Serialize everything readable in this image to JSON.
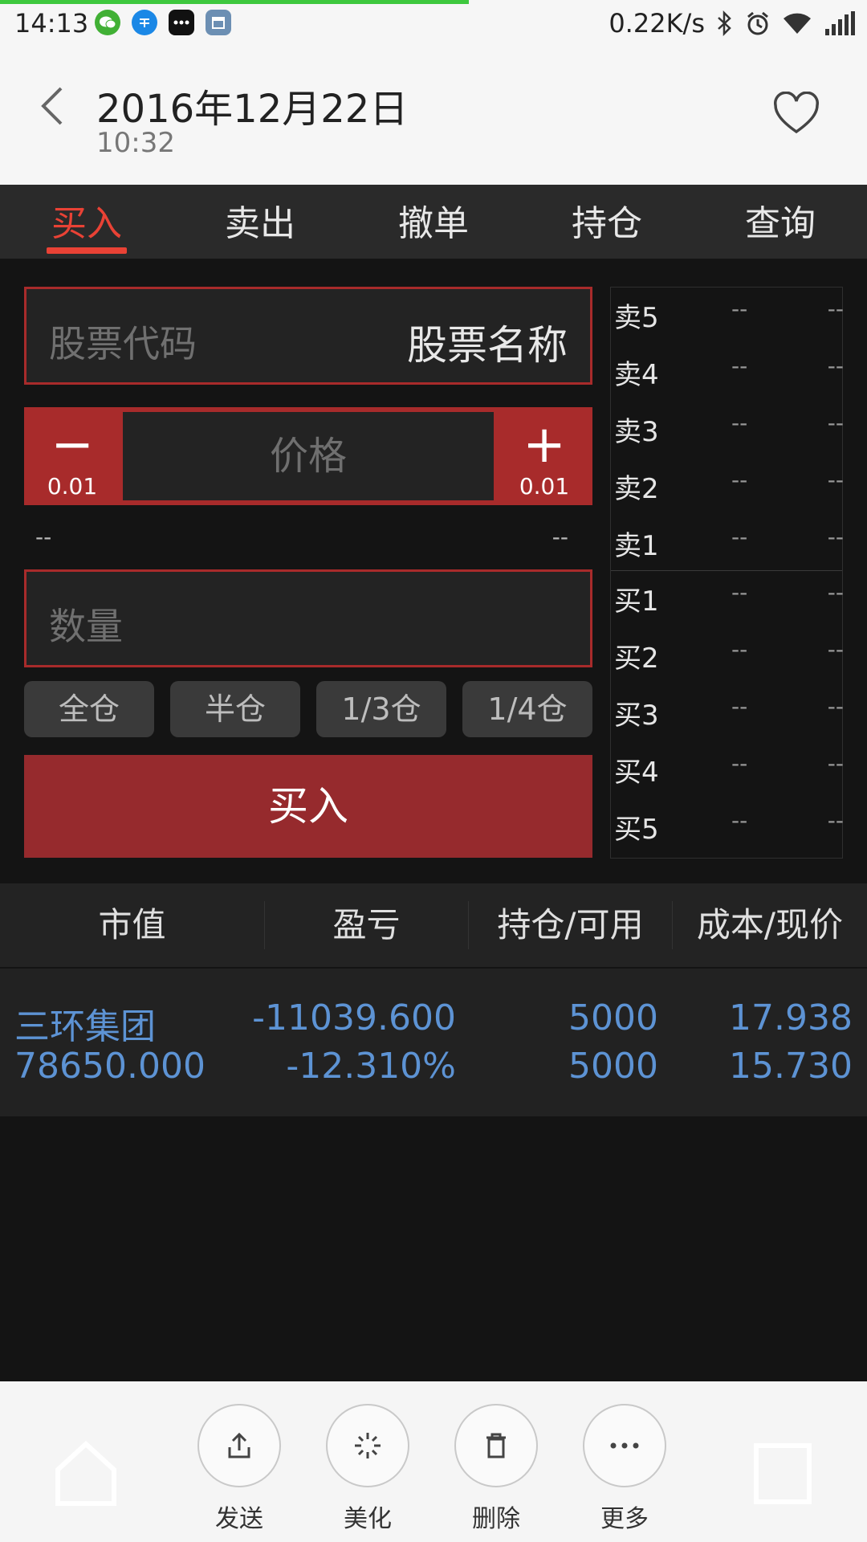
{
  "status_bar": {
    "time": "14:13",
    "speed": "0.22K/s",
    "icons": [
      "wechat-icon",
      "zhihu-icon",
      "tic-icon",
      "calendar-icon",
      "bluetooth-icon",
      "alarm-icon",
      "wifi-icon",
      "signal-icon"
    ]
  },
  "header": {
    "date": "2016年12月22日",
    "time": "10:32"
  },
  "tabs": [
    {
      "label": "买入",
      "active": true
    },
    {
      "label": "卖出",
      "active": false
    },
    {
      "label": "撤单",
      "active": false
    },
    {
      "label": "持仓",
      "active": false
    },
    {
      "label": "查询",
      "active": false
    }
  ],
  "trade": {
    "code_placeholder": "股票代码",
    "name_label": "股票名称",
    "price_placeholder": "价格",
    "minus_symbol": "−",
    "plus_symbol": "+",
    "step_value": "0.01",
    "limit_low": "--",
    "limit_high": "--",
    "qty_placeholder": "数量",
    "position_buttons": [
      "全仓",
      "半仓",
      "1/3仓",
      "1/4仓"
    ],
    "buy_button": "买入"
  },
  "order_book": {
    "sell": [
      {
        "label": "卖5",
        "price": "--",
        "volume": "--"
      },
      {
        "label": "卖4",
        "price": "--",
        "volume": "--"
      },
      {
        "label": "卖3",
        "price": "--",
        "volume": "--"
      },
      {
        "label": "卖2",
        "price": "--",
        "volume": "--"
      },
      {
        "label": "卖1",
        "price": "--",
        "volume": "--"
      }
    ],
    "buy": [
      {
        "label": "买1",
        "price": "--",
        "volume": "--"
      },
      {
        "label": "买2",
        "price": "--",
        "volume": "--"
      },
      {
        "label": "买3",
        "price": "--",
        "volume": "--"
      },
      {
        "label": "买4",
        "price": "--",
        "volume": "--"
      },
      {
        "label": "买5",
        "price": "--",
        "volume": "--"
      }
    ]
  },
  "holdings": {
    "headers": [
      "市值",
      "盈亏",
      "持仓/可用",
      "成本/现价"
    ],
    "rows": [
      {
        "name": "三环集团",
        "market_value": "78650.000",
        "pnl": "-11039.600",
        "pnl_pct": "-12.310%",
        "position": "5000",
        "available": "5000",
        "cost": "17.938",
        "price": "15.730"
      }
    ]
  },
  "share_bar": {
    "items": [
      {
        "label": "发送",
        "icon": "share-upload-icon"
      },
      {
        "label": "美化",
        "icon": "sparkle-icon"
      },
      {
        "label": "删除",
        "icon": "trash-icon"
      },
      {
        "label": "更多",
        "icon": "more-dots-icon"
      }
    ]
  }
}
